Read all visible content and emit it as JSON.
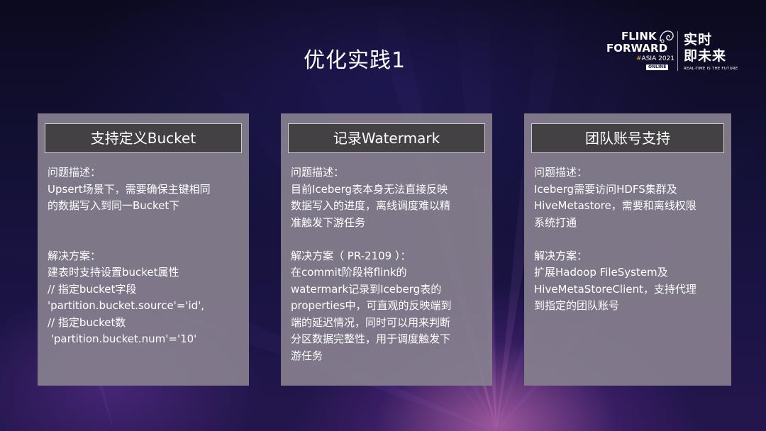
{
  "slide": {
    "title": "优化实践1"
  },
  "logo": {
    "line1": "FLINK",
    "line2": "FORWARD",
    "hash": "#",
    "event": "ASIA 2021",
    "badge": "ONLINE",
    "cn_line1": "实时",
    "cn_line2": "即未来",
    "tagline": "REAL-TIME IS THE FUTURE"
  },
  "cards": [
    {
      "header": "支持定义Bucket",
      "problem_label": "问题描述：",
      "problem_lines": [
        "Upsert场景下，需要确保主键相同",
        "的数据写入到同一Bucket下"
      ],
      "solution_label": "解决方案：",
      "solution_lines": [
        "建表时支持设置bucket属性",
        "// 指定bucket字段",
        "'partition.bucket.source'='id',",
        "// 指定bucket数",
        " 'partition.bucket.num'='10'"
      ]
    },
    {
      "header": "记录Watermark",
      "problem_label": "问题描述：",
      "problem_lines": [
        "目前Iceberg表本身无法直接反映",
        "数据写入的进度，离线调度难以精",
        "准触发下游任务"
      ],
      "solution_label": "解决方案（ PR-2109 ）：",
      "solution_lines": [
        "在commit阶段将flink的",
        "watermark记录到Iceberg表的",
        "properties中，可直观的反映端到",
        "端的延迟情况，同时可以用来判断",
        "分区数据完整性，用于调度触发下",
        "游任务"
      ]
    },
    {
      "header": "团队账号支持",
      "problem_label": "问题描述：",
      "problem_lines": [
        "Iceberg需要访问HDFS集群及",
        "HiveMetastore，需要和离线权限",
        "系统打通"
      ],
      "solution_label": "解决方案：",
      "solution_lines": [
        "扩展Hadoop FileSystem及",
        "HiveMetaStoreClient，支持代理",
        "到指定的团队账号"
      ]
    }
  ],
  "colors": {
    "card_background": "#867f8e",
    "header_background": "#434143",
    "text": "#ffffff",
    "accent": "#e9ad3a"
  }
}
